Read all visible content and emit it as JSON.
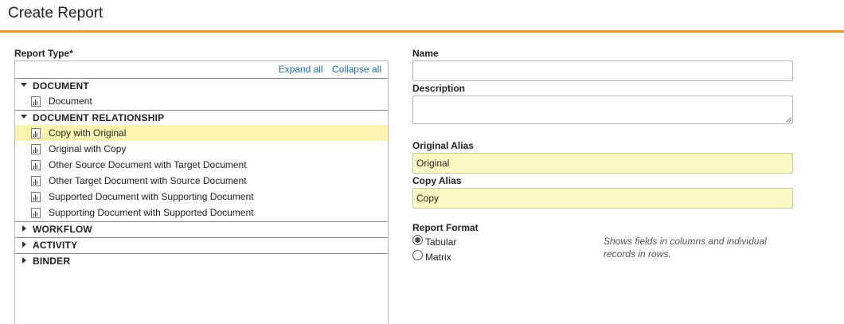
{
  "page": {
    "title": "Create Report"
  },
  "report_type": {
    "label": "Report Type*",
    "expand_all": "Expand all",
    "collapse_all": "Collapse all",
    "groups": [
      {
        "name": "DOCUMENT",
        "expanded": true,
        "items": [
          "Document"
        ]
      },
      {
        "name": "DOCUMENT RELATIONSHIP",
        "expanded": true,
        "items": [
          "Copy with Original",
          "Original with Copy",
          "Other Source Document with Target Document",
          "Other Target Document with Source Document",
          "Supported Document with Supporting Document",
          "Supporting Document with Supported Document"
        ]
      },
      {
        "name": "WORKFLOW",
        "expanded": false,
        "items": []
      },
      {
        "name": "ACTIVITY",
        "expanded": false,
        "items": []
      },
      {
        "name": "BINDER",
        "expanded": false,
        "items": []
      }
    ],
    "selected_item": "Copy with Original"
  },
  "form": {
    "name_label": "Name",
    "name_value": "",
    "description_label": "Description",
    "description_value": "",
    "original_alias_label": "Original Alias",
    "original_alias_value": "Original",
    "copy_alias_label": "Copy Alias",
    "copy_alias_value": "Copy",
    "report_format_label": "Report Format",
    "format_options": [
      "Tabular",
      "Matrix"
    ],
    "selected_format": "Tabular",
    "format_hint": "Shows fields in columns and individual records in rows."
  },
  "colors": {
    "accent": "#e8922e",
    "link": "#1a6aa8",
    "highlight": "#fdf4b1",
    "alias_field": "#fcf9c3"
  }
}
